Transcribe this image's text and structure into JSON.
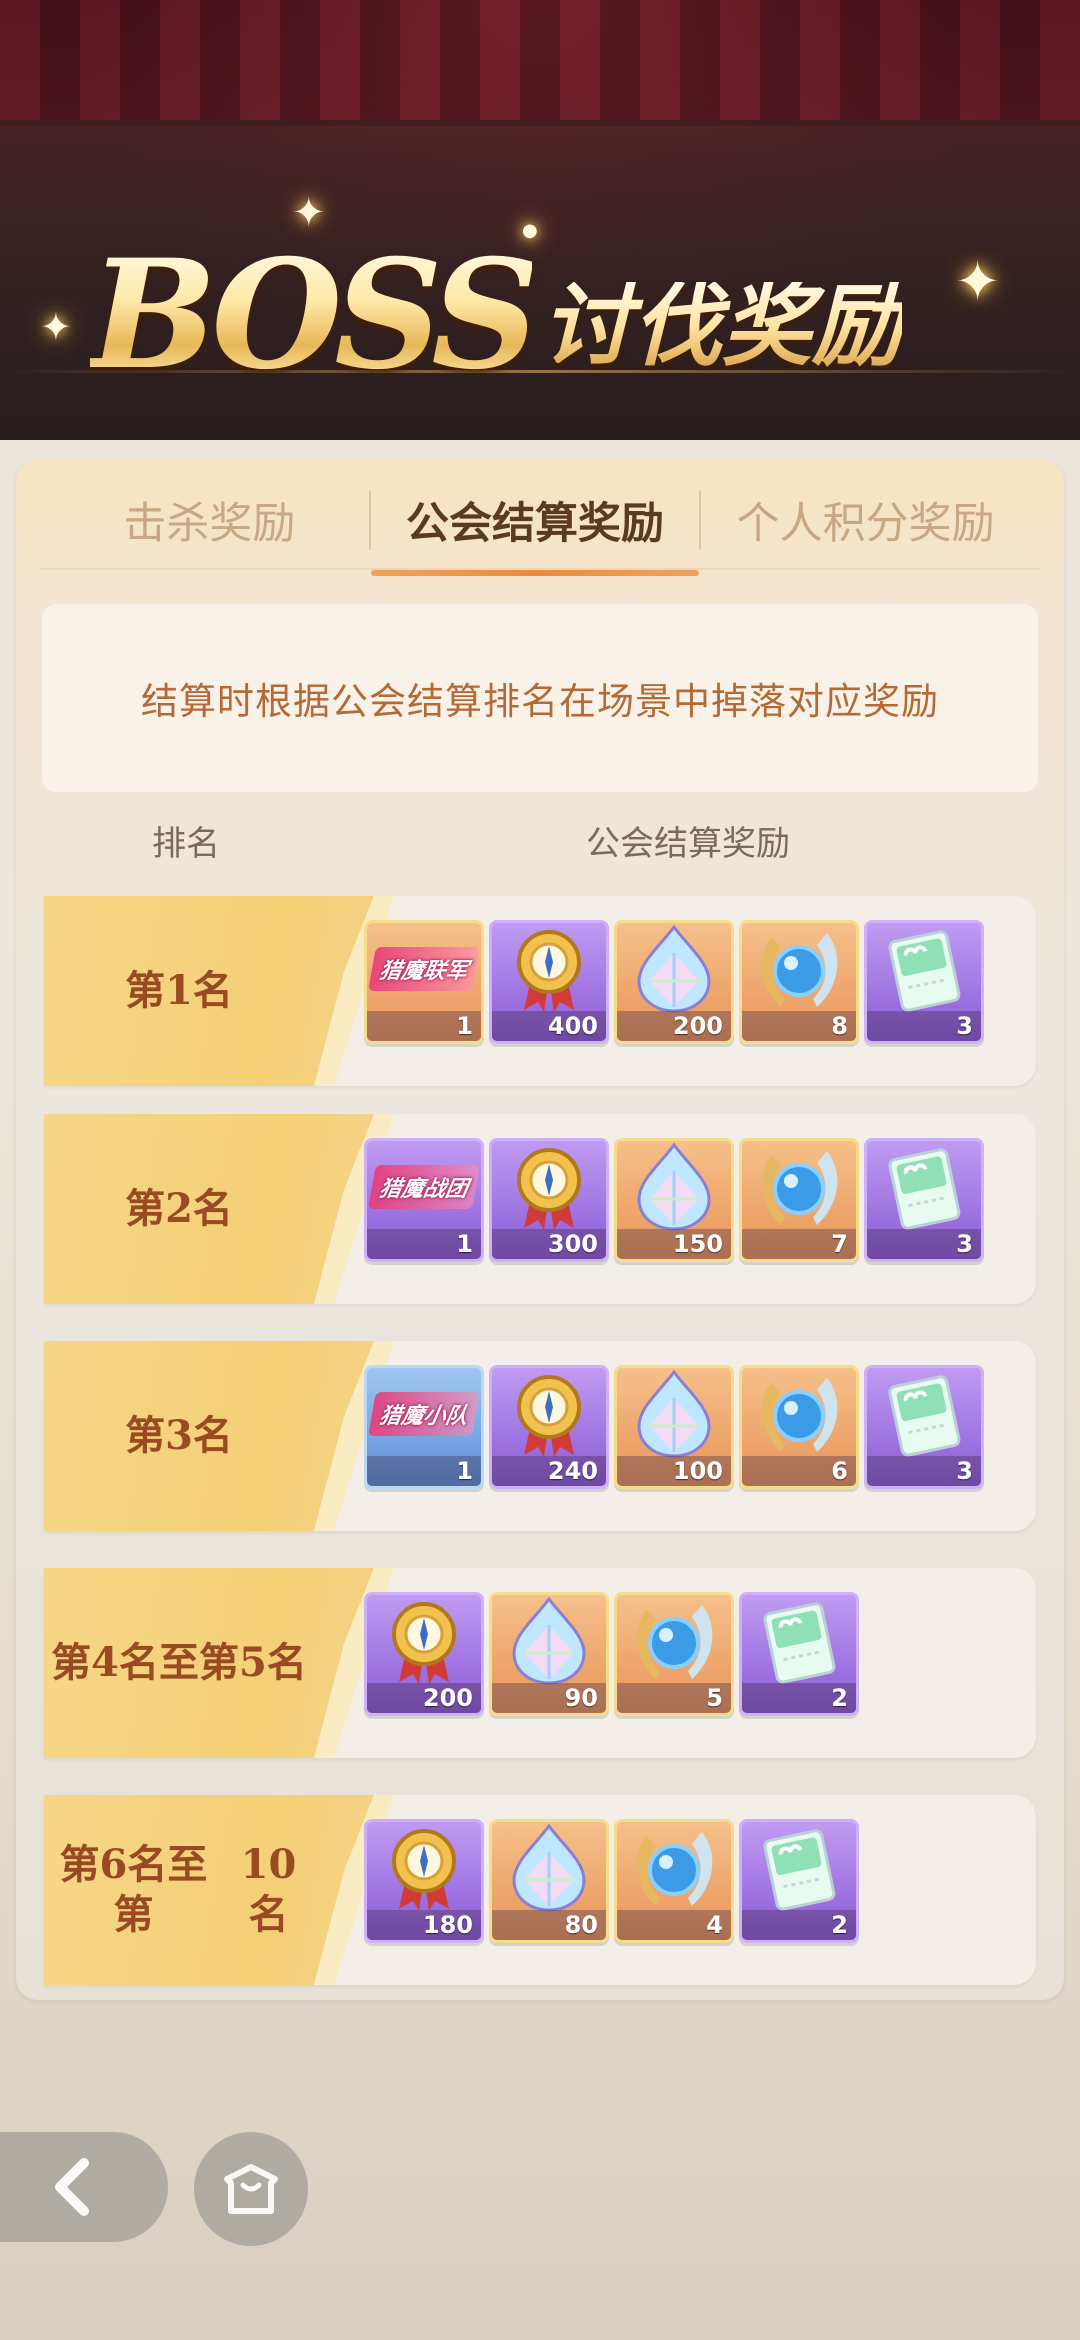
{
  "header": {
    "title_latin": "BOSS",
    "title_cn": "讨伐奖励"
  },
  "tabs": [
    {
      "label": "击杀奖励",
      "active": false
    },
    {
      "label": "公会结算奖励",
      "active": true
    },
    {
      "label": "个人积分奖励",
      "active": false
    }
  ],
  "notice": "结算时根据公会结算排名在场景中掉落对应奖励",
  "columns": {
    "rank": "排名",
    "reward": "公会结算奖励"
  },
  "rows": [
    {
      "rank": "第1名",
      "items": [
        {
          "icon": "guild-title-icon",
          "badge": "猎魔联军",
          "color": "orange",
          "qty": "1"
        },
        {
          "icon": "medal-icon",
          "color": "purple",
          "qty": "400"
        },
        {
          "icon": "crystal-icon",
          "color": "orange",
          "qty": "200"
        },
        {
          "icon": "orb-icon",
          "color": "orange",
          "qty": "8"
        },
        {
          "icon": "ticket-icon",
          "color": "purple",
          "qty": "3"
        }
      ]
    },
    {
      "rank": "第2名",
      "items": [
        {
          "icon": "guild-title-icon",
          "badge": "猎魔战团",
          "color": "purple",
          "qty": "1"
        },
        {
          "icon": "medal-icon",
          "color": "purple",
          "qty": "300"
        },
        {
          "icon": "crystal-icon",
          "color": "orange",
          "qty": "150"
        },
        {
          "icon": "orb-icon",
          "color": "orange",
          "qty": "7"
        },
        {
          "icon": "ticket-icon",
          "color": "purple",
          "qty": "3"
        }
      ]
    },
    {
      "rank": "第3名",
      "items": [
        {
          "icon": "guild-title-icon",
          "badge": "猎魔小队",
          "color": "blue",
          "qty": "1"
        },
        {
          "icon": "medal-icon",
          "color": "purple",
          "qty": "240"
        },
        {
          "icon": "crystal-icon",
          "color": "orange",
          "qty": "100"
        },
        {
          "icon": "orb-icon",
          "color": "orange",
          "qty": "6"
        },
        {
          "icon": "ticket-icon",
          "color": "purple",
          "qty": "3"
        }
      ]
    },
    {
      "rank": "第4名至第5名",
      "rank_line1": "第4名至第",
      "rank_line2": "5名",
      "items": [
        {
          "icon": "medal-icon",
          "color": "purple",
          "qty": "200"
        },
        {
          "icon": "crystal-icon",
          "color": "orange",
          "qty": "90"
        },
        {
          "icon": "orb-icon",
          "color": "orange",
          "qty": "5"
        },
        {
          "icon": "ticket-icon",
          "color": "purple",
          "qty": "2"
        }
      ]
    },
    {
      "rank": "第6名至第10名",
      "rank_line1": "第6名至第",
      "rank_line2": "10名",
      "items": [
        {
          "icon": "medal-icon",
          "color": "purple",
          "qty": "180"
        },
        {
          "icon": "crystal-icon",
          "color": "orange",
          "qty": "80"
        },
        {
          "icon": "orb-icon",
          "color": "orange",
          "qty": "4"
        },
        {
          "icon": "ticket-icon",
          "color": "purple",
          "qty": "2"
        }
      ]
    }
  ],
  "nav": {
    "back_icon": "back-arrow-icon",
    "home_icon": "home-icon"
  }
}
